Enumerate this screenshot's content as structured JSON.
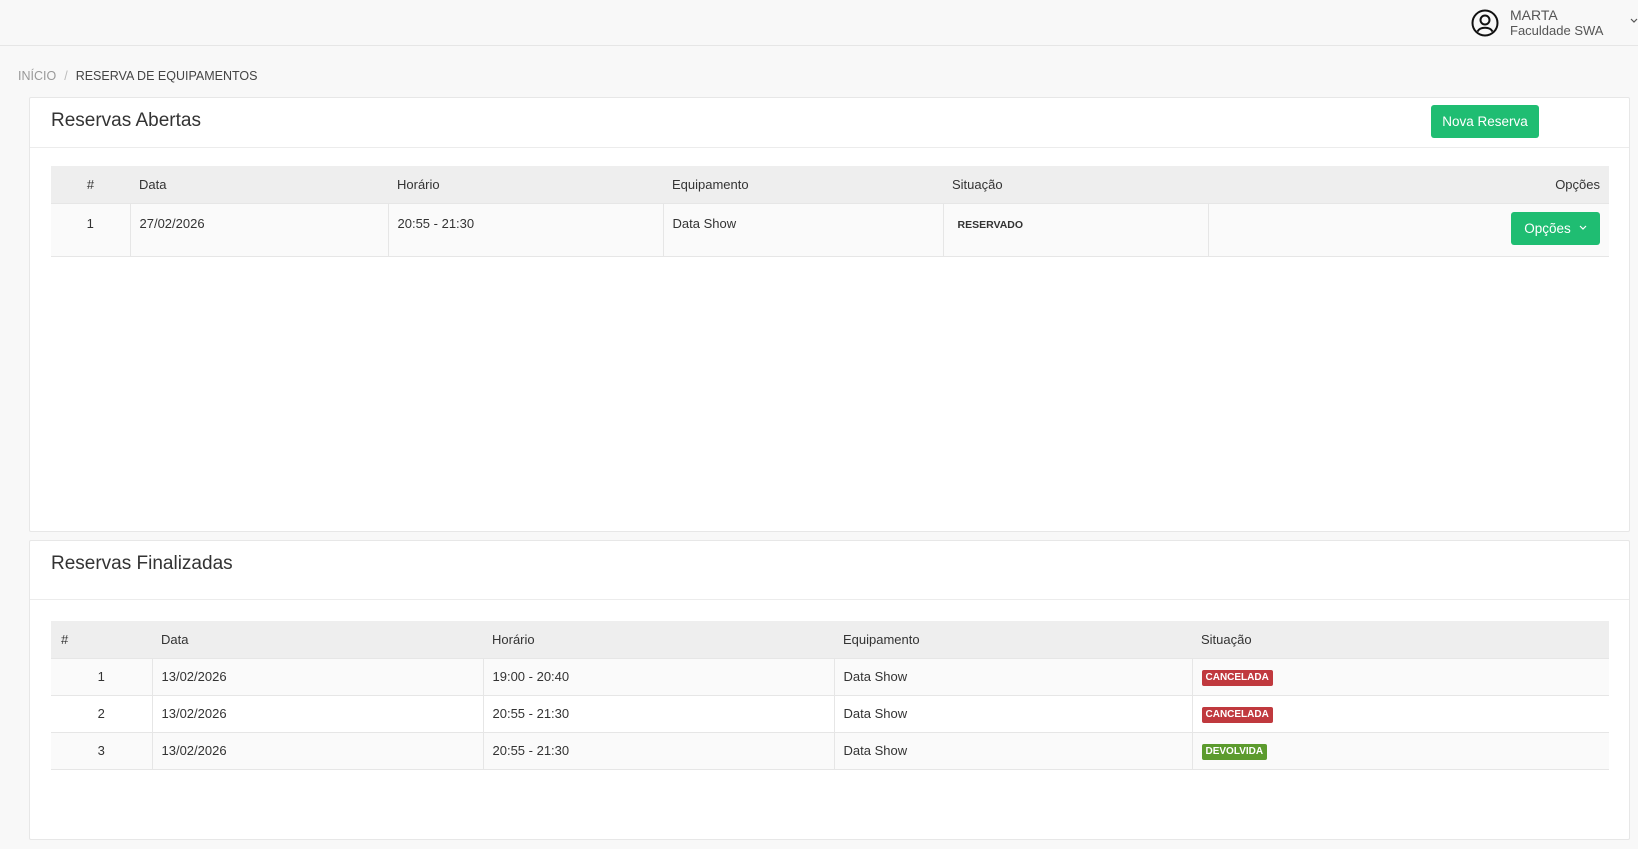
{
  "header": {
    "user_name": "MARTA",
    "user_org": "Faculdade SWA",
    "icons": {
      "user": "user-circle-icon",
      "caret": "chevron-down-icon"
    }
  },
  "breadcrumb": {
    "home": "INÍCIO",
    "separator": "/",
    "current": "RESERVA DE EQUIPAMENTOS"
  },
  "open_reservations": {
    "title": "Reservas Abertas",
    "new_button": "Nova Reserva",
    "columns": [
      "#",
      "Data",
      "Horário",
      "Equipamento",
      "Situação",
      "Opções"
    ],
    "rows": [
      {
        "num": "1",
        "date": "27/02/2026",
        "time": "20:55 - 21:30",
        "equipment": "Data Show",
        "status": "RESERVADO",
        "options_label": "Opções"
      }
    ]
  },
  "finished_reservations": {
    "title": "Reservas Finalizadas",
    "columns": [
      "#",
      "Data",
      "Horário",
      "Equipamento",
      "Situação"
    ],
    "rows": [
      {
        "num": "1",
        "date": "13/02/2026",
        "time": "19:00 - 20:40",
        "equipment": "Data Show",
        "status": "CANCELADA"
      },
      {
        "num": "2",
        "date": "13/02/2026",
        "time": "20:55 - 21:30",
        "equipment": "Data Show",
        "status": "CANCELADA"
      },
      {
        "num": "3",
        "date": "13/02/2026",
        "time": "20:55 - 21:30",
        "equipment": "Data Show",
        "status": "DEVOLVIDA"
      }
    ]
  },
  "colors": {
    "primary_green": "#1fbd72",
    "cancel_red": "#c0393e",
    "returned_green": "#5c9b2e"
  }
}
